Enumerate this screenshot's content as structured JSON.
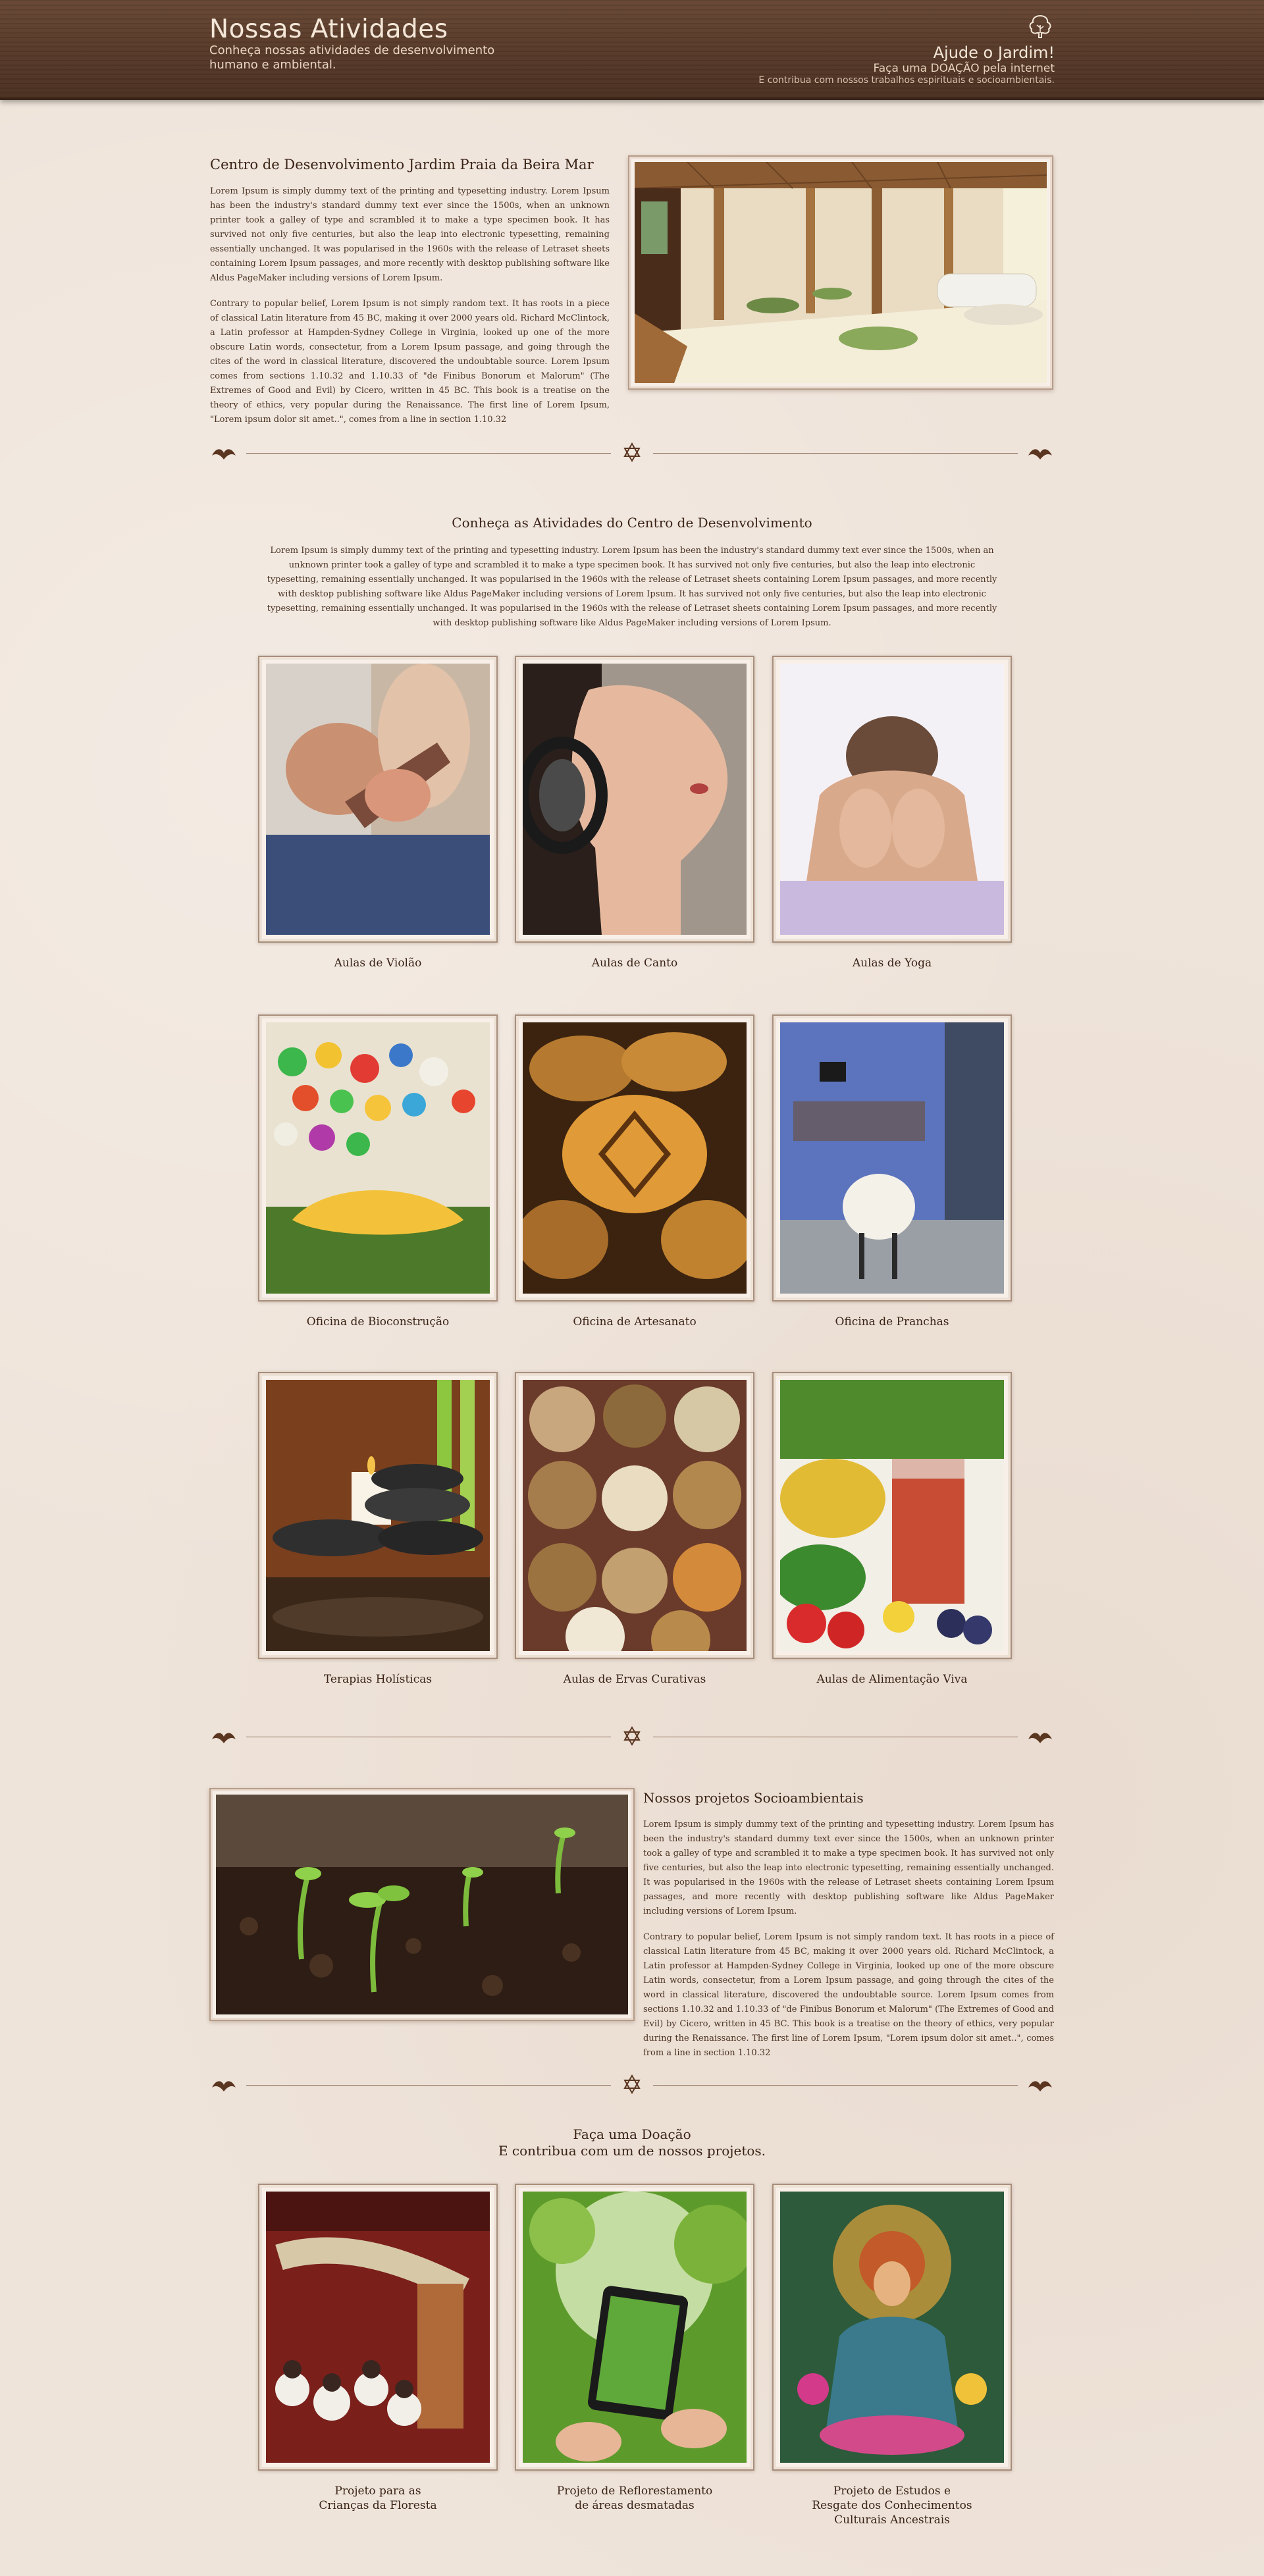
{
  "header": {
    "title": "Nossas Atividades",
    "subtitle": "Conheça nossas atividades de desenvolvimento humano e ambiental.",
    "donate_title": "Ajude o Jardim!",
    "donate_line": "Faça uma DOAÇÃO pela internet",
    "donate_small": "E contribua com nossos trabalhos espirituais e socioambientais."
  },
  "intro": {
    "title": "Centro de Desenvolvimento Jardim Praia da Beira Mar",
    "p1": "Lorem Ipsum is simply dummy text of the printing and typesetting industry. Lorem Ipsum has been the industry's standard dummy text ever since the 1500s, when an unknown printer took a galley of type and scrambled it to make a type specimen book. It has survived not only five centuries, but also the leap into electronic typesetting, remaining essentially unchanged. It was popularised in the 1960s with the release of Letraset sheets containing Lorem Ipsum passages, and more recently with desktop publishing software like Aldus PageMaker including versions of Lorem Ipsum.",
    "p2": "Contrary to popular belief, Lorem Ipsum is not simply random text. It has roots in a piece of classical Latin literature from 45 BC, making it over 2000 years old. Richard McClintock, a Latin professor at Hampden-Sydney College in Virginia, looked up one of the more obscure Latin words, consectetur, from a Lorem Ipsum passage, and going through the cites of the word in classical literature, discovered the undoubtable source. Lorem Ipsum comes from sections 1.10.32 and 1.10.33 of \"de Finibus Bonorum et Malorum\" (The Extremes of Good and Evil) by Cicero, written in 45 BC. This book is a treatise on the theory of ethics, very popular during the Renaissance. The first line of Lorem Ipsum, \"Lorem ipsum dolor sit amet..\", comes from a line in section 1.10.32"
  },
  "activities": {
    "title": "Conheça as Atividades do Centro de Desenvolvimento",
    "text": "Lorem Ipsum is simply dummy text of the printing and typesetting industry. Lorem Ipsum has been the industry's standard dummy text ever since the 1500s, when an unknown printer took a galley of type and scrambled it to make a type specimen book. It has survived not only five centuries, but also the leap into electronic typesetting, remaining essentially unchanged. It was popularised in the 1960s with the release of Letraset sheets containing Lorem Ipsum passages, and more recently with desktop publishing software like Aldus PageMaker including versions of Lorem Ipsum.  It has survived not only five centuries, but also the leap into electronic typesetting, remaining essentially unchanged. It was popularised in the 1960s with the release of Letraset sheets containing Lorem Ipsum passages, and more recently with desktop publishing software like Aldus PageMaker including versions of Lorem Ipsum.",
    "items": [
      {
        "label": "Aulas de Violão"
      },
      {
        "label": "Aulas de Canto"
      },
      {
        "label": "Aulas de Yoga"
      },
      {
        "label": "Oficina de Bioconstrução"
      },
      {
        "label": "Oficina de Artesanato"
      },
      {
        "label": "Oficina de Pranchas"
      },
      {
        "label": "Terapias Holísticas"
      },
      {
        "label": "Aulas de Ervas Curativas"
      },
      {
        "label": "Aulas de Alimentação Viva"
      }
    ]
  },
  "projects": {
    "title": "Nossos projetos Socioambientais",
    "p1": "Lorem Ipsum is simply dummy text of the printing and typesetting industry. Lorem Ipsum has been the industry's standard dummy text ever since the 1500s, when an unknown printer took a galley of type and scrambled it to make a type specimen book. It has survived not only five centuries, but also the leap into electronic typesetting, remaining essentially unchanged. It was popularised in the 1960s with the release of Letraset sheets containing Lorem Ipsum passages, and more recently with desktop publishing software like Aldus PageMaker including versions of Lorem Ipsum.",
    "p2": "Contrary to popular belief, Lorem Ipsum is not simply random text. It has roots in a piece of classical Latin literature from 45 BC, making it over 2000 years old. Richard McClintock, a Latin professor at Hampden-Sydney College in Virginia, looked up one of the more obscure Latin words, consectetur, from a Lorem Ipsum passage, and going through the cites of the word in classical literature, discovered the undoubtable source. Lorem Ipsum comes from sections 1.10.32 and 1.10.33 of \"de Finibus Bonorum et Malorum\" (The Extremes of Good and Evil) by Cicero, written in 45 BC. This book is a treatise on the theory of ethics, very popular during the Renaissance. The first line of Lorem Ipsum, \"Lorem ipsum dolor sit amet..\", comes from a line in section 1.10.32"
  },
  "donation": {
    "title_line1": "Faça uma Doação",
    "title_line2": "E contribua com um de nossos projetos.",
    "items": [
      {
        "line1": "Projeto para as",
        "line2": "Crianças da Floresta",
        "line3": ""
      },
      {
        "line1": "Projeto de Reflorestamento",
        "line2": "de áreas desmatadas",
        "line3": ""
      },
      {
        "line1": "Projeto de Estudos e",
        "line2": "Resgate dos Conhecimentos",
        "line3": "Culturais Ancestrais"
      }
    ]
  }
}
